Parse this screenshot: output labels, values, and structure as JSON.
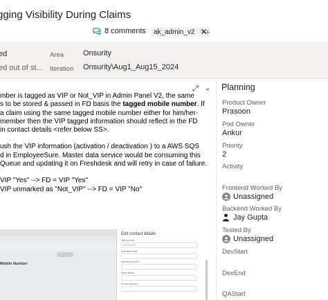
{
  "header": {
    "title": "gging Visibility During Claims",
    "comments_label": "8 comments",
    "tag": "ak_admin_v2"
  },
  "fields": {
    "state_value": "ed",
    "reason_value": "ed out of st...",
    "area_label": "Area",
    "area_value": "Onsurity",
    "iteration_label": "Iteration",
    "iteration_value": "Onsurity\\Aug1_Aug15_2024"
  },
  "description": {
    "lines": [
      "mber is tagged as VIP or Not_VIP in Admin Panel V2, the same",
      "s to be stored & passed in FD basis the ",
      "a claim using the same tagged mobile number either for him/her-",
      " member then the VIP tagged information should reflect in the FD",
      " in contact details <refer below SS>.",
      "ush the VIP information (activation / deactivation ) to a AWS SQS",
      "d in EmployeeSure. Master data service would be consuming this",
      "Queue and updating it on Freshdesk and will retry in case of failure.",
      " VIP \"Yes\" --> FD = VIP \"Yes\"",
      " VIP unmarked as \"Not_VIP\" --> FD = VIP \"No\""
    ],
    "bold_fragment": "tagged mobile number",
    "bold_suffix": ". If"
  },
  "embedded_screenshot": {
    "mobile_label": "Mobile Number",
    "panel_title": "Edit contact details",
    "fields": [
      {
        "label": "Work phone",
        "value": "9876543210"
      },
      {
        "label": "Activation Date",
        "value": ""
      },
      {
        "label": "Internet Email ID",
        "value": ""
      },
      {
        "label": "Sales Name",
        "value": ""
      },
      {
        "label": "Frozen as level",
        "value": ""
      }
    ]
  },
  "planning": {
    "title": "Planning",
    "product_owner_label": "Product Owner",
    "product_owner_value": "Prasoon",
    "pod_owner_label": "Pod Owner",
    "pod_owner_value": "Ankur",
    "priority_label": "Priority",
    "priority_value": "2",
    "activity_label": "Activity",
    "frontend_label": "Frontend Worked By",
    "frontend_value": "Unassigned",
    "backend_label": "Backend Worked By",
    "backend_value": "Jay Gupta",
    "tested_label": "Tested By",
    "tested_value": "Unassigned",
    "devstart_label": "DevStart",
    "devend_label": "DevEnd",
    "qastart_label": "QAStart"
  },
  "colors": {
    "band": "#f3f2f1",
    "text": "#201f1e",
    "muted": "#605e5c"
  }
}
